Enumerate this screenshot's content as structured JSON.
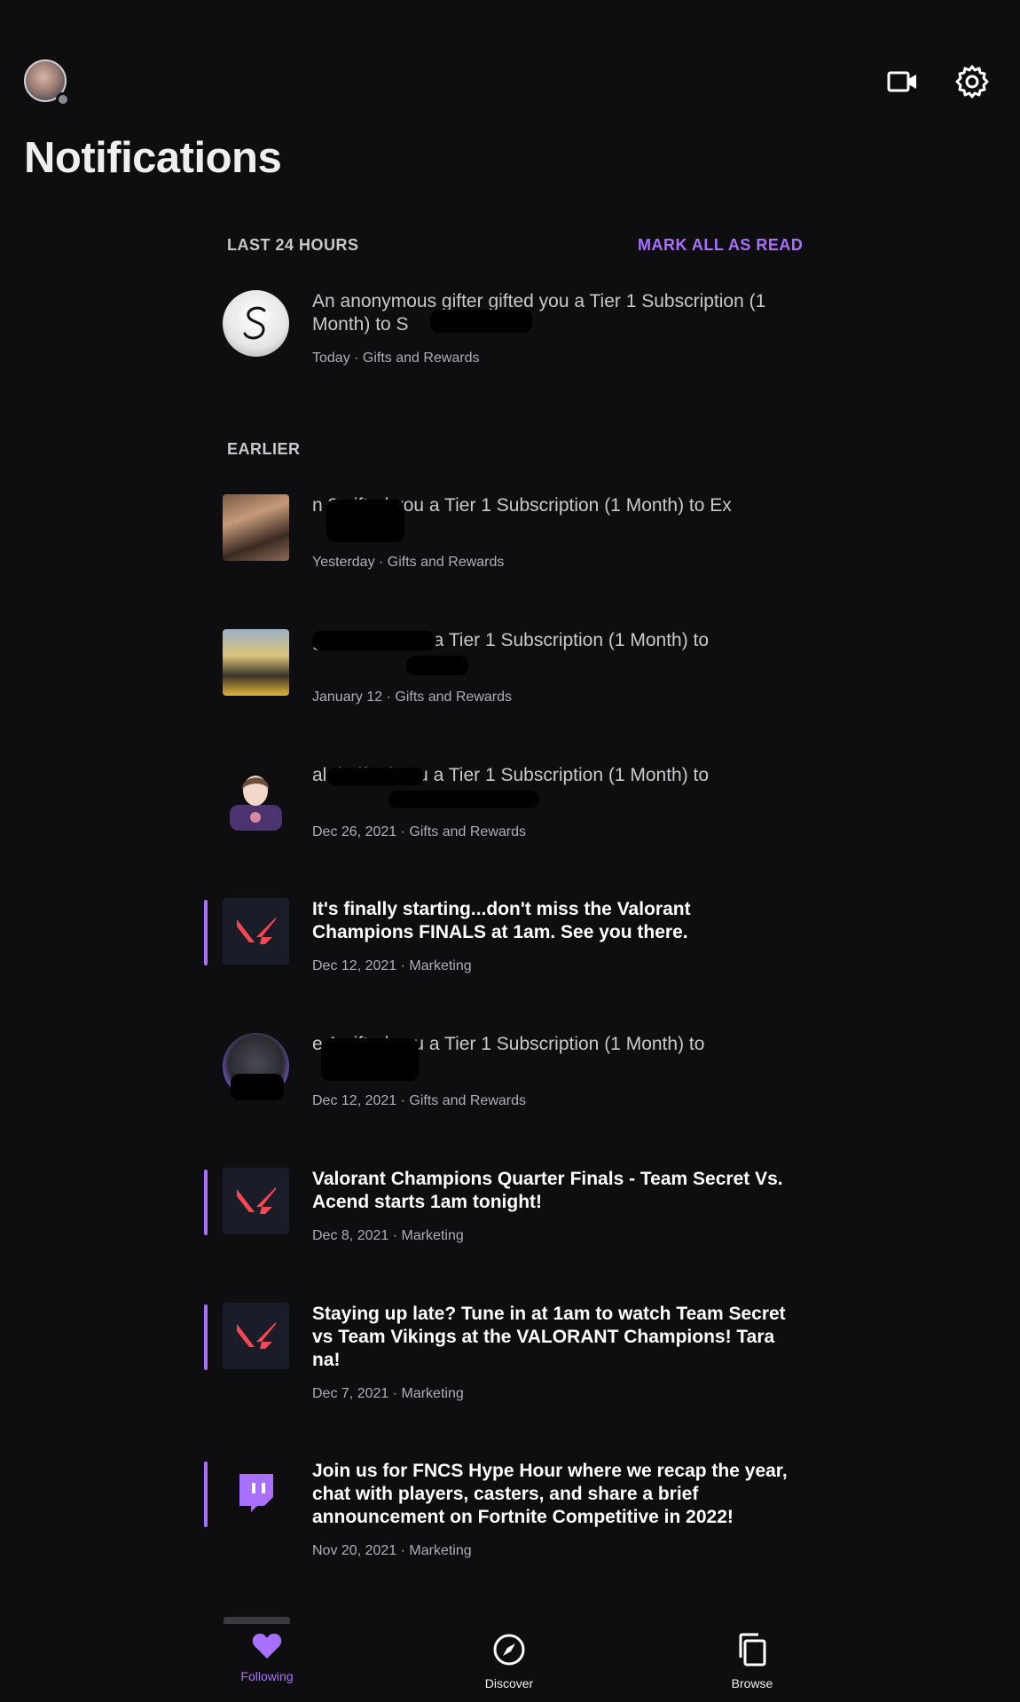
{
  "header": {
    "title": "Notifications",
    "actions": [
      "camera-icon",
      "settings-icon"
    ]
  },
  "sections": {
    "last24": {
      "label": "LAST 24 HOURS",
      "action": "MARK ALL AS READ"
    },
    "earlier": {
      "label": "EARLIER"
    }
  },
  "notifications": [
    {
      "text": "An anonymous gifter gifted you a Tier 1 Subscription (1 Month) to S",
      "meta": "Today · Gifts and Rewards",
      "unread": false
    },
    {
      "text": "n 3 gifted you a Tier 1 Subscription (1 Month) to Ex",
      "meta": "Yesterday · Gifts and Rewards",
      "unread": false
    },
    {
      "text": "gi 1 gifted you a Tier 1 Subscription (1 Month) to",
      "meta": "January 12 · Gifts and Rewards",
      "unread": false
    },
    {
      "text": "al d gifted you a Tier 1 Subscription (1 Month) to",
      "meta": "Dec 26, 2021 · Gifts and Rewards",
      "unread": false
    },
    {
      "text": "It's finally starting...don't miss the Valorant Champions FINALS at 1am. See you there.",
      "meta": "Dec 12, 2021 · Marketing",
      "unread": true
    },
    {
      "text": "e 1 gifted you a Tier 1 Subscription (1 Month) to",
      "meta": "Dec 12, 2021 · Gifts and Rewards",
      "unread": false
    },
    {
      "text": "Valorant Champions Quarter Finals - Team Secret Vs. Acend starts 1am tonight!",
      "meta": "Dec 8, 2021 · Marketing",
      "unread": true
    },
    {
      "text": "Staying up late? Tune in at 1am to watch Team Secret vs Team Vikings at the VALORANT Champions! Tara na!",
      "meta": "Dec 7, 2021 · Marketing",
      "unread": true
    },
    {
      "text": "Join us for FNCS Hype Hour where we recap the year, chat with players, casters, and share a brief announcement on Fortnite Competitive in 2022!",
      "meta": "Nov 20, 2021 · Marketing",
      "unread": true
    }
  ],
  "bottom_nav": {
    "following": "Following",
    "discover": "Discover",
    "browse": "Browse"
  },
  "colors": {
    "background": "#0e0e10",
    "accent": "#a970ff",
    "valorant_red": "#ff4655"
  }
}
